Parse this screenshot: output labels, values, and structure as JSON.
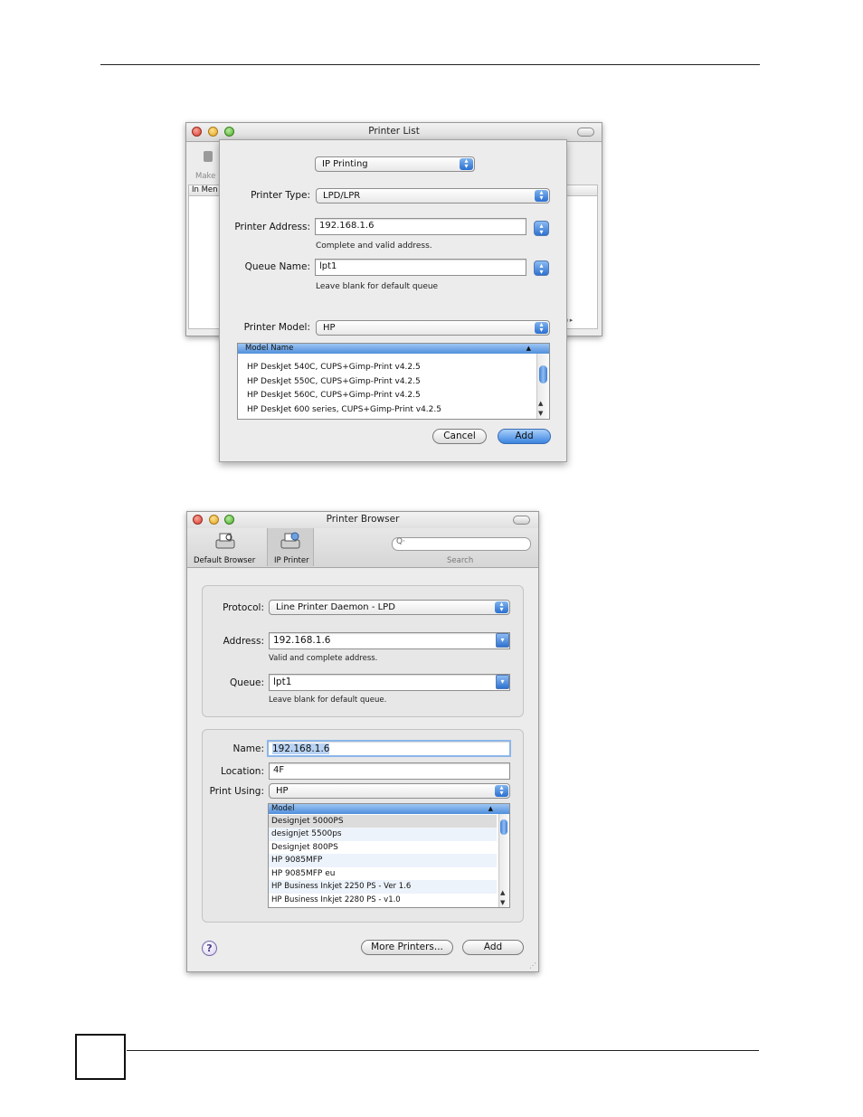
{
  "printer_list": {
    "title": "Printer List",
    "toolbar_make": "Make",
    "col_in_menu": "In Men",
    "sheet": {
      "connection_popup": "IP Printing",
      "printer_type_label": "Printer Type:",
      "printer_type_value": "LPD/LPR",
      "address_label": "Printer Address:",
      "address_value": "192.168.1.6",
      "address_hint": "Complete and valid address.",
      "queue_label": "Queue Name:",
      "queue_value": "lpt1",
      "queue_hint": "Leave blank for default queue",
      "model_label": "Printer Model:",
      "model_value": "HP",
      "list_header": "Model Name",
      "list_rows": [
        "HP DeskJet 540C, CUPS+Gimp-Print v4.2.5",
        "HP DeskJet 550C, CUPS+Gimp-Print v4.2.5",
        "HP DeskJet 560C, CUPS+Gimp-Print v4.2.5",
        "HP DeskJet 600 series, CUPS+Gimp-Print v4.2.5"
      ],
      "cancel_label": "Cancel",
      "add_label": "Add"
    }
  },
  "printer_browser": {
    "title": "Printer Browser",
    "tab_default": "Default Browser",
    "tab_ip": "IP Printer",
    "search_label": "Search",
    "protocol_label": "Protocol:",
    "protocol_value": "Line Printer Daemon - LPD",
    "address_label": "Address:",
    "address_value": "192.168.1.6",
    "address_hint": "Valid and complete address.",
    "queue_label": "Queue:",
    "queue_value": "lpt1",
    "queue_hint": "Leave blank for default queue.",
    "name_label": "Name:",
    "name_value": "192.168.1.6",
    "location_label": "Location:",
    "location_value": "4F",
    "print_using_label": "Print Using:",
    "print_using_value": "HP",
    "list_header": "Model",
    "list_rows": [
      "Designjet 5000PS",
      "designjet 5500ps",
      "Designjet 800PS",
      "HP 9085MFP",
      "HP 9085MFP eu",
      "HP Business Inkjet 2250 PS - Ver 1.6",
      "HP Business Inkjet 2280 PS - v1.0"
    ],
    "help_label": "?",
    "more_printers_label": "More Printers...",
    "add_label": "Add"
  },
  "colors": {
    "accent": "#3a85e0",
    "header": "#4f8fdc"
  }
}
